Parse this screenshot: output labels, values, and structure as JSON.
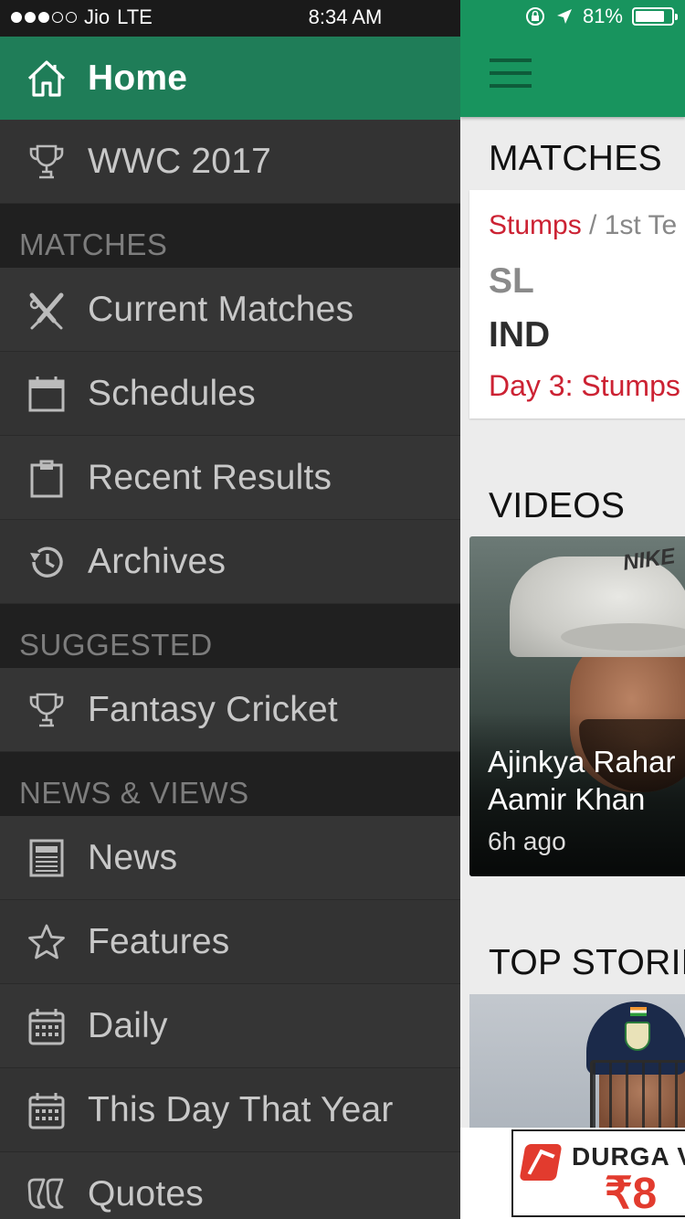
{
  "status_bar": {
    "carrier": "Jio",
    "network": "LTE",
    "time": "8:34 AM",
    "battery": "81%",
    "battery_level": 0.81,
    "signal_bars": 3,
    "signal_max": 5
  },
  "drawer": {
    "home": {
      "label": "Home",
      "icon": "home-icon"
    },
    "wwc": {
      "label": "WWC 2017",
      "icon": "trophy-icon"
    },
    "sections": {
      "matches": "MATCHES",
      "suggested": "SUGGESTED",
      "news_views": "NEWS & VIEWS"
    },
    "matches_items": [
      {
        "label": "Current Matches",
        "icon": "crossed-bats-icon"
      },
      {
        "label": "Schedules",
        "icon": "calendar-icon"
      },
      {
        "label": "Recent Results",
        "icon": "clipboard-icon"
      },
      {
        "label": "Archives",
        "icon": "history-icon"
      }
    ],
    "suggested_items": [
      {
        "label": "Fantasy Cricket",
        "icon": "trophy-icon"
      }
    ],
    "news_items": [
      {
        "label": "News",
        "icon": "newspaper-icon"
      },
      {
        "label": "Features",
        "icon": "star-icon"
      },
      {
        "label": "Daily",
        "icon": "calendar-grid-icon"
      },
      {
        "label": "This Day That Year",
        "icon": "calendar-grid-icon"
      },
      {
        "label": "Quotes",
        "icon": "quote-icon"
      }
    ]
  },
  "main": {
    "matches_title": "MATCHES",
    "match_card": {
      "status": "Stumps",
      "separator": " / ",
      "match_no": "1st Te",
      "team1": "SL",
      "team2": "IND",
      "day_status": "Day 3: Stumps"
    },
    "videos_title": "VIDEOS",
    "video_card": {
      "title_line1": "Ajinkya Rahar",
      "title_line2": "Aamir Khan",
      "time": "6h ago",
      "cap_brand": "NIKE"
    },
    "top_stories_title": "TOP STORIE",
    "ad": {
      "brand": "DURGA V",
      "price": "₹8"
    }
  },
  "colors": {
    "accent_green": "#18945e",
    "drawer_active": "#1f7d58",
    "drawer_bg": "#333333",
    "section_bg": "#202020",
    "alert_red": "#cc2233"
  }
}
